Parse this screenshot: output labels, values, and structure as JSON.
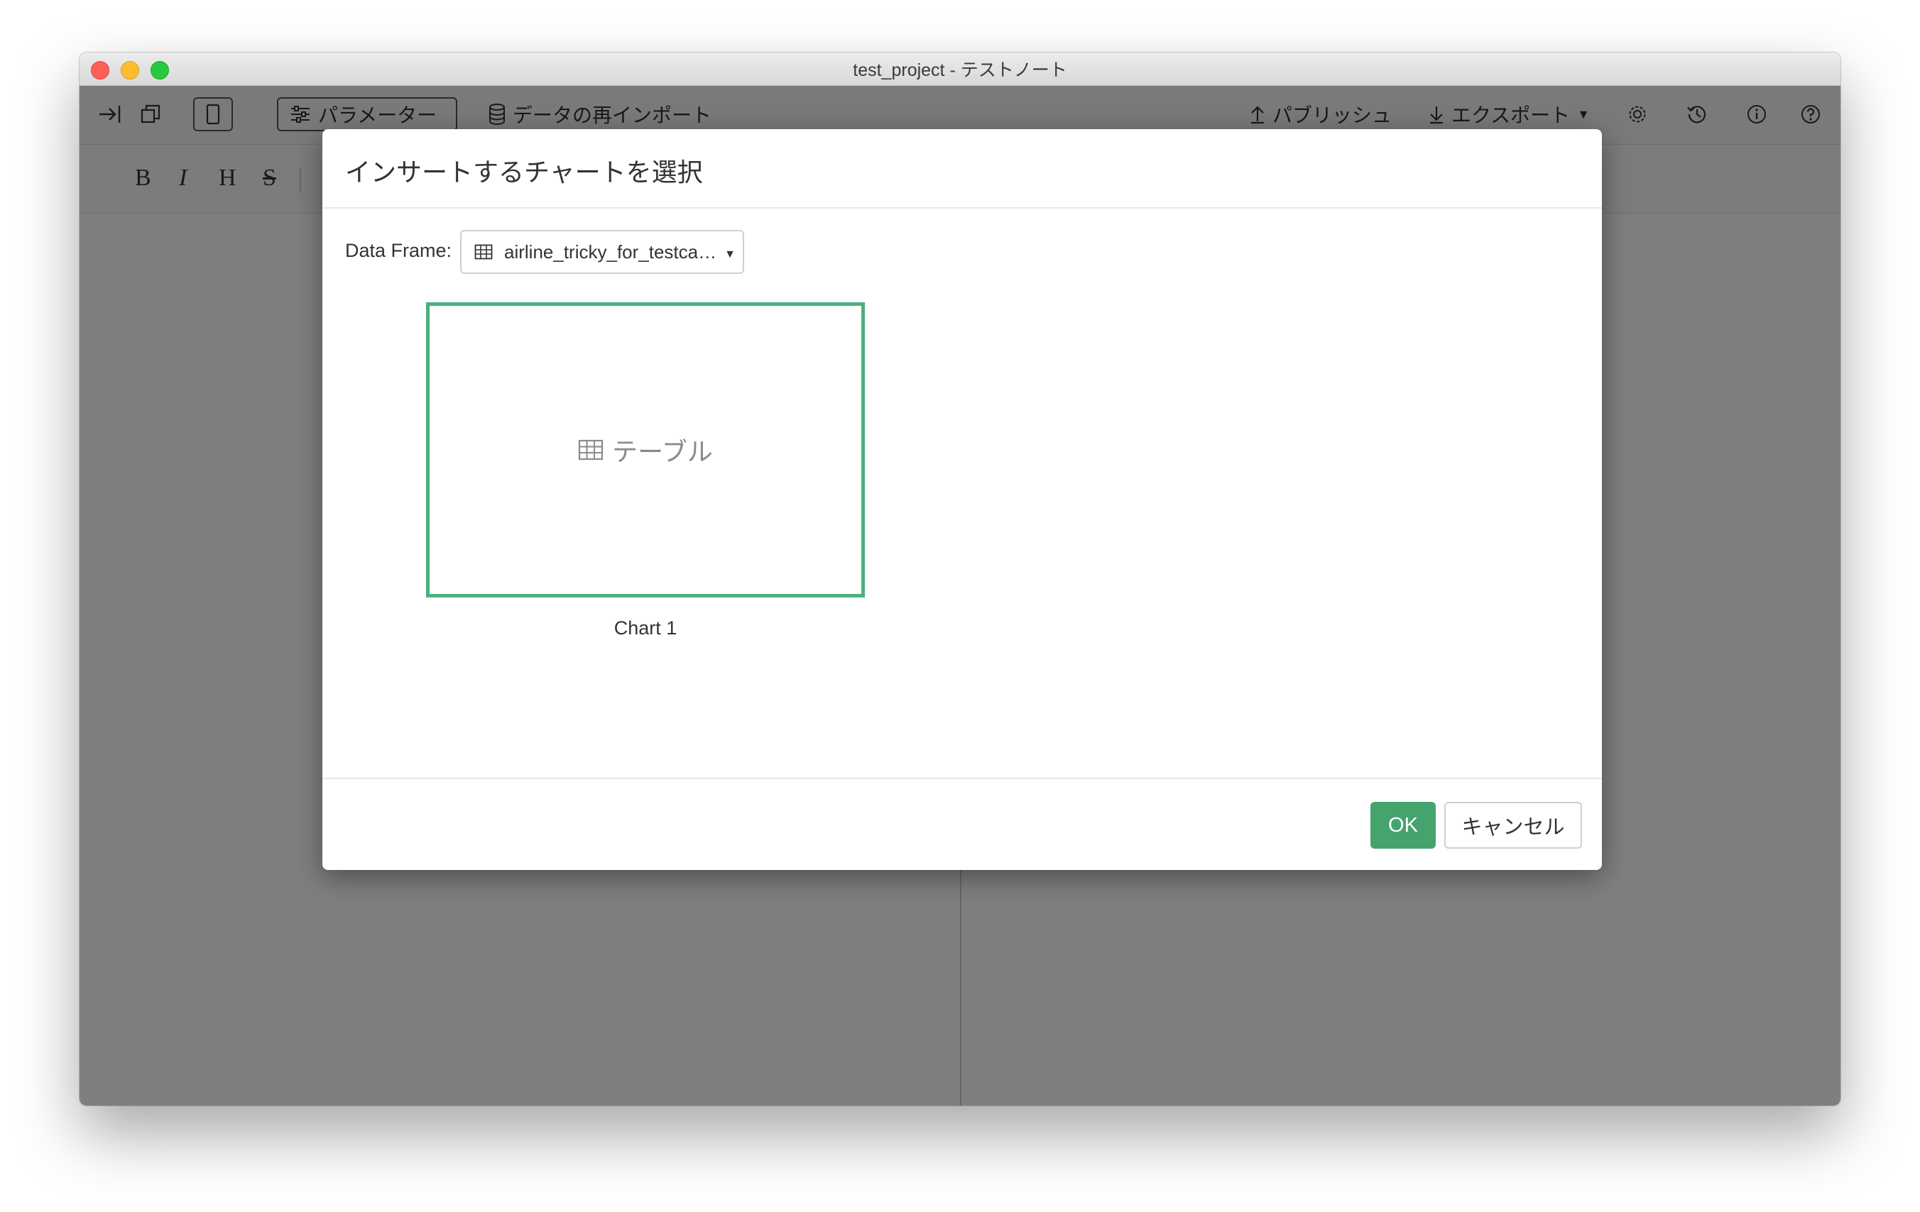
{
  "window": {
    "title": "test_project - テストノート"
  },
  "toolbar": {
    "parameters_label": "パラメーター",
    "reimport_label": "データの再インポート",
    "publish_label": "パブリッシュ",
    "export_label": "エクスポート"
  },
  "format_bar": {
    "bold": "B",
    "italic": "I",
    "heading": "H",
    "strike": "S"
  },
  "dialog": {
    "title": "インサートするチャートを選択",
    "data_frame_label": "Data Frame:",
    "data_frame_value": "airline_tricky_for_testca…",
    "charts": [
      {
        "type_label": "テーブル",
        "caption": "Chart 1"
      }
    ],
    "ok_label": "OK",
    "cancel_label": "キャンセル"
  },
  "colors": {
    "accent": "#45a46e",
    "selected_border": "#4caf7d",
    "overlay": "rgba(0,0,0,0.5)"
  },
  "icons": [
    "indent-icon",
    "copy-icon",
    "device-icon",
    "sliders-icon",
    "database-icon",
    "upload-icon",
    "download-icon",
    "caret-down-icon",
    "gear-icon",
    "history-icon",
    "info-icon",
    "help-icon",
    "table-icon"
  ]
}
